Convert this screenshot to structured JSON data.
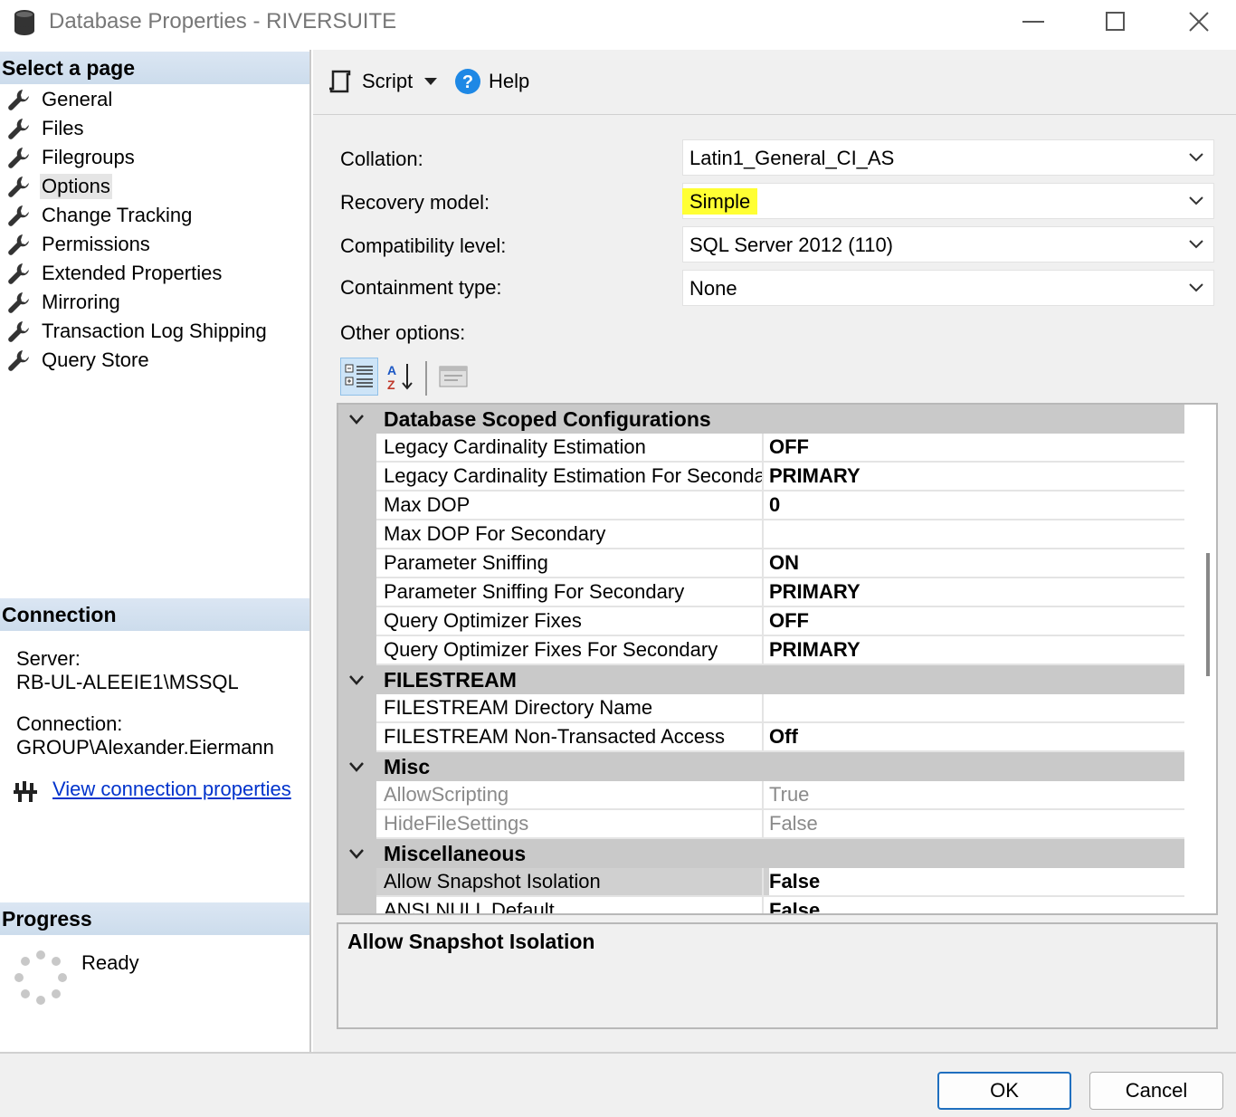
{
  "window": {
    "title": "Database Properties - RIVERSUITE",
    "icons": [
      "database-icon",
      "minimize-icon",
      "maximize-icon",
      "close-icon"
    ]
  },
  "left": {
    "select_page_header": "Select a page",
    "pages": [
      {
        "label": "General",
        "selected": false
      },
      {
        "label": "Files",
        "selected": false
      },
      {
        "label": "Filegroups",
        "selected": false
      },
      {
        "label": "Options",
        "selected": true
      },
      {
        "label": "Change Tracking",
        "selected": false
      },
      {
        "label": "Permissions",
        "selected": false
      },
      {
        "label": "Extended Properties",
        "selected": false
      },
      {
        "label": "Mirroring",
        "selected": false
      },
      {
        "label": "Transaction Log Shipping",
        "selected": false
      },
      {
        "label": "Query Store",
        "selected": false
      }
    ],
    "connection_header": "Connection",
    "server_label": "Server:",
    "server_value": "RB-UL-ALEEIE1\\MSSQL",
    "connection_label": "Connection:",
    "connection_value": "GROUP\\Alexander.Eiermann",
    "view_connection_link": "View connection properties",
    "progress_header": "Progress",
    "progress_status": "Ready"
  },
  "toolbar": {
    "script_label": "Script",
    "help_label": "Help"
  },
  "form": {
    "collation_label": "Collation:",
    "collation_value": "Latin1_General_CI_AS",
    "recovery_label": "Recovery model:",
    "recovery_value": "Simple",
    "compat_label": "Compatibility level:",
    "compat_value": "SQL Server 2012 (110)",
    "containment_label": "Containment type:",
    "containment_value": "None",
    "other_options_label": "Other options:",
    "highlight_color": "#ffff33"
  },
  "grid": {
    "cat_dsc": "Database Scoped Configurations",
    "cat_filestream": "FILESTREAM",
    "cat_misc": "Misc",
    "cat_miscellaneous": "Miscellaneous",
    "rows": [
      {
        "name": "Legacy Cardinality Estimation",
        "value": "OFF"
      },
      {
        "name": "Legacy Cardinality Estimation For Secondary",
        "value": "PRIMARY"
      },
      {
        "name": "Max DOP",
        "value": "0"
      },
      {
        "name": "Max DOP For Secondary",
        "value": ""
      },
      {
        "name": "Parameter Sniffing",
        "value": "ON"
      },
      {
        "name": "Parameter Sniffing For Secondary",
        "value": "PRIMARY"
      },
      {
        "name": "Query Optimizer Fixes",
        "value": "OFF"
      },
      {
        "name": "Query Optimizer Fixes For Secondary",
        "value": "PRIMARY"
      },
      {
        "name": "FILESTREAM Directory Name",
        "value": ""
      },
      {
        "name": "FILESTREAM Non-Transacted Access",
        "value": "Off"
      },
      {
        "name": "AllowScripting",
        "value": "True"
      },
      {
        "name": "HideFileSettings",
        "value": "False"
      },
      {
        "name": "Allow Snapshot Isolation",
        "value": "False"
      },
      {
        "name": "ANSI NULL Default",
        "value": "False"
      }
    ],
    "description_title": "Allow Snapshot Isolation"
  },
  "buttons": {
    "ok": "OK",
    "cancel": "Cancel"
  }
}
